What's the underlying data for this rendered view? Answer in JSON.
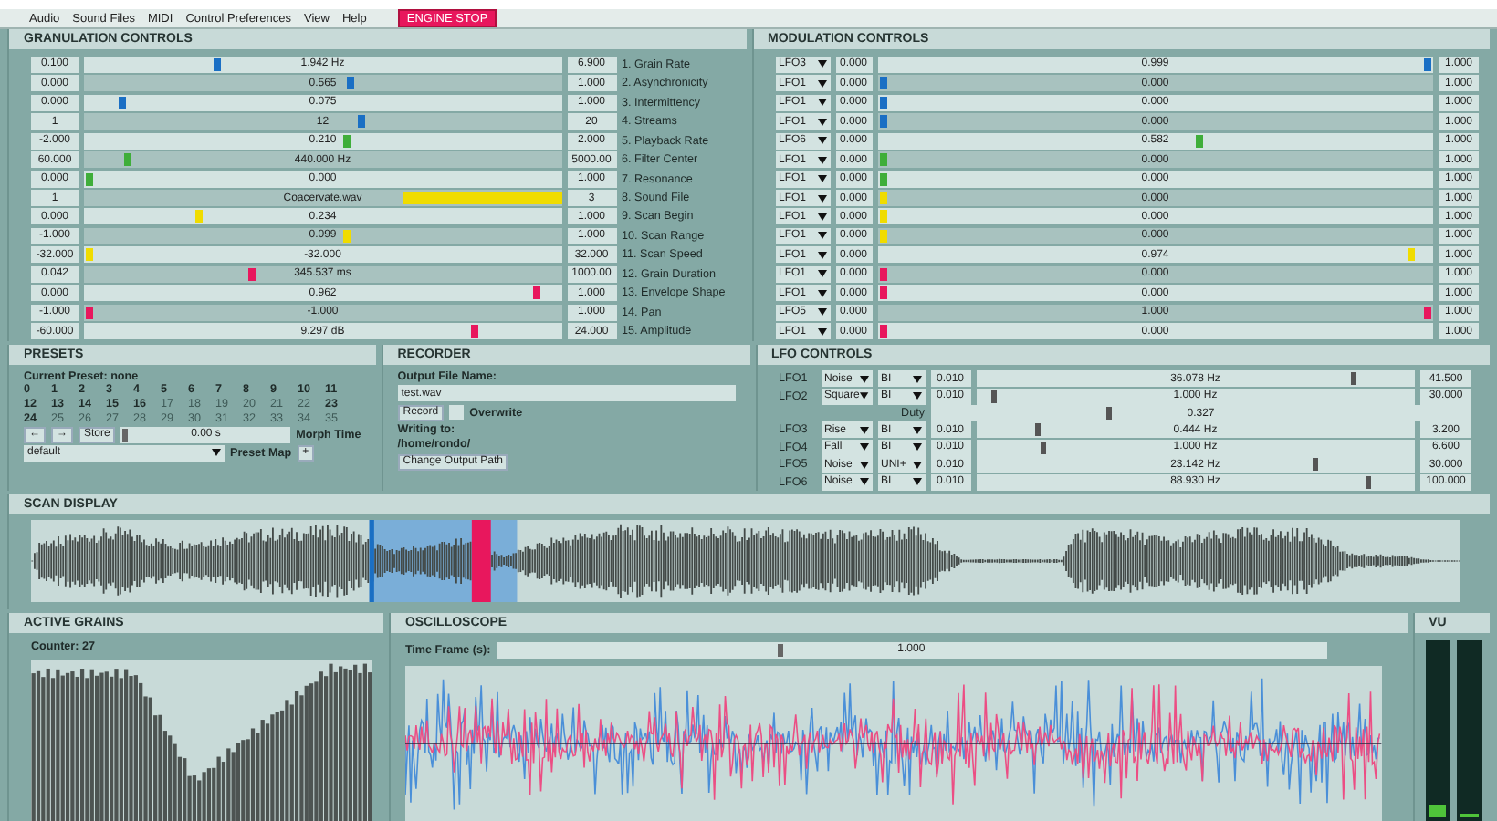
{
  "menu": {
    "items": [
      "Audio",
      "Sound Files",
      "MIDI",
      "Control Preferences",
      "View",
      "Help"
    ],
    "engine_button": "ENGINE STOP"
  },
  "granulation": {
    "title": "GRANULATION CONTROLS",
    "rows": [
      {
        "min": "0.100",
        "value": "1.942 Hz",
        "level": 0.28,
        "max": "6.900",
        "label": "1. Grain Rate",
        "color": "#1a6fc4",
        "kind": "slider"
      },
      {
        "min": "0.000",
        "value": "0.565",
        "level": 0.56,
        "max": "1.000",
        "label": "2. Asynchronicity",
        "color": "#1a6fc4",
        "kind": "slider"
      },
      {
        "min": "0.000",
        "value": "0.075",
        "level": 0.08,
        "max": "1.000",
        "label": "3. Intermittency",
        "color": "#1a6fc4",
        "kind": "slider"
      },
      {
        "min": "1",
        "value": "12",
        "level": 0.58,
        "max": "20",
        "label": "4. Streams",
        "color": "#1a6fc4",
        "kind": "slider"
      },
      {
        "min": "-2.000",
        "value": "0.210",
        "level": 0.55,
        "max": "2.000",
        "label": "5. Playback Rate",
        "color": "#3fae3a",
        "kind": "slider"
      },
      {
        "min": "60.000",
        "value": "440.000 Hz",
        "level": 0.09,
        "max": "5000.00",
        "label": "6. Filter Center",
        "color": "#3fae3a",
        "kind": "slider"
      },
      {
        "min": "0.000",
        "value": "0.000",
        "level": 0.01,
        "max": "1.000",
        "label": "7. Resonance",
        "color": "#3fae3a",
        "kind": "slider"
      },
      {
        "min": "1",
        "value": "Coacervate.wav",
        "max": "3",
        "label": "8. Sound File",
        "color": "#f0dc00",
        "kind": "file"
      },
      {
        "min": "0.000",
        "value": "0.234",
        "level": 0.24,
        "max": "1.000",
        "label": "9. Scan Begin",
        "color": "#f0dc00",
        "kind": "slider"
      },
      {
        "min": "-1.000",
        "value": "0.099",
        "level": 0.55,
        "max": "1.000",
        "label": "10. Scan Range",
        "color": "#f0dc00",
        "kind": "slider"
      },
      {
        "min": "-32.000",
        "value": "-32.000",
        "level": 0.01,
        "max": "32.000",
        "label": "11. Scan Speed",
        "color": "#f0dc00",
        "kind": "slider"
      },
      {
        "min": "0.042",
        "value": "345.537 ms",
        "level": 0.35,
        "max": "1000.00",
        "label": "12. Grain Duration",
        "color": "#e8175d",
        "kind": "slider"
      },
      {
        "min": "0.000",
        "value": "0.962",
        "level": 0.95,
        "max": "1.000",
        "label": "13. Envelope Shape",
        "color": "#e8175d",
        "kind": "slider"
      },
      {
        "min": "-1.000",
        "value": "-1.000",
        "level": 0.01,
        "max": "1.000",
        "label": "14. Pan",
        "color": "#e8175d",
        "kind": "slider"
      },
      {
        "min": "-60.000",
        "value": "9.297 dB",
        "level": 0.82,
        "max": "24.000",
        "label": "15. Amplitude",
        "color": "#e8175d",
        "kind": "slider"
      }
    ]
  },
  "modulation": {
    "title": "MODULATION CONTROLS",
    "rows": [
      {
        "source": "LFO3",
        "min": "0.000",
        "value": "0.999",
        "level": 0.99,
        "max": "1.000",
        "color": "#1a6fc4"
      },
      {
        "source": "LFO1",
        "min": "0.000",
        "value": "0.000",
        "level": 0.01,
        "max": "1.000",
        "color": "#1a6fc4"
      },
      {
        "source": "LFO1",
        "min": "0.000",
        "value": "0.000",
        "level": 0.01,
        "max": "1.000",
        "color": "#1a6fc4"
      },
      {
        "source": "LFO1",
        "min": "0.000",
        "value": "0.000",
        "level": 0.01,
        "max": "1.000",
        "color": "#1a6fc4"
      },
      {
        "source": "LFO6",
        "min": "0.000",
        "value": "0.582",
        "level": 0.58,
        "max": "1.000",
        "color": "#3fae3a"
      },
      {
        "source": "LFO1",
        "min": "0.000",
        "value": "0.000",
        "level": 0.01,
        "max": "1.000",
        "color": "#3fae3a"
      },
      {
        "source": "LFO1",
        "min": "0.000",
        "value": "0.000",
        "level": 0.01,
        "max": "1.000",
        "color": "#3fae3a"
      },
      {
        "source": "LFO1",
        "min": "0.000",
        "value": "0.000",
        "level": 0.01,
        "max": "1.000",
        "color": "#f0dc00"
      },
      {
        "source": "LFO1",
        "min": "0.000",
        "value": "0.000",
        "level": 0.01,
        "max": "1.000",
        "color": "#f0dc00"
      },
      {
        "source": "LFO1",
        "min": "0.000",
        "value": "0.000",
        "level": 0.01,
        "max": "1.000",
        "color": "#f0dc00"
      },
      {
        "source": "LFO1",
        "min": "0.000",
        "value": "0.974",
        "level": 0.96,
        "max": "1.000",
        "color": "#f0dc00"
      },
      {
        "source": "LFO1",
        "min": "0.000",
        "value": "0.000",
        "level": 0.01,
        "max": "1.000",
        "color": "#e8175d"
      },
      {
        "source": "LFO1",
        "min": "0.000",
        "value": "0.000",
        "level": 0.01,
        "max": "1.000",
        "color": "#e8175d"
      },
      {
        "source": "LFO5",
        "min": "0.000",
        "value": "1.000",
        "level": 0.99,
        "max": "1.000",
        "color": "#e8175d"
      },
      {
        "source": "LFO1",
        "min": "0.000",
        "value": "0.000",
        "level": 0.01,
        "max": "1.000",
        "color": "#e8175d"
      }
    ]
  },
  "presets": {
    "title": "PRESETS",
    "current": "Current Preset: none",
    "slots": [
      {
        "label": "0",
        "stored": true
      },
      {
        "label": "1",
        "stored": true
      },
      {
        "label": "2",
        "stored": true
      },
      {
        "label": "3",
        "stored": true
      },
      {
        "label": "4",
        "stored": true
      },
      {
        "label": "5",
        "stored": true
      },
      {
        "label": "6",
        "stored": true
      },
      {
        "label": "7",
        "stored": true
      },
      {
        "label": "8",
        "stored": true
      },
      {
        "label": "9",
        "stored": true
      },
      {
        "label": "10",
        "stored": true
      },
      {
        "label": "11",
        "stored": true
      },
      {
        "label": "12",
        "stored": true
      },
      {
        "label": "13",
        "stored": true
      },
      {
        "label": "14",
        "stored": true
      },
      {
        "label": "15",
        "stored": true
      },
      {
        "label": "16",
        "stored": true
      },
      {
        "label": "17",
        "stored": false
      },
      {
        "label": "18",
        "stored": false
      },
      {
        "label": "19",
        "stored": false
      },
      {
        "label": "20",
        "stored": false
      },
      {
        "label": "21",
        "stored": false
      },
      {
        "label": "22",
        "stored": false
      },
      {
        "label": "23",
        "stored": true
      },
      {
        "label": "24",
        "stored": true
      },
      {
        "label": "25",
        "stored": false
      },
      {
        "label": "26",
        "stored": false
      },
      {
        "label": "27",
        "stored": false
      },
      {
        "label": "28",
        "stored": false
      },
      {
        "label": "29",
        "stored": false
      },
      {
        "label": "30",
        "stored": false
      },
      {
        "label": "31",
        "stored": false
      },
      {
        "label": "32",
        "stored": false
      },
      {
        "label": "33",
        "stored": false
      },
      {
        "label": "34",
        "stored": false
      },
      {
        "label": "35",
        "stored": false
      }
    ],
    "prev": "←",
    "next": "→",
    "store": "Store",
    "morph": {
      "value": "0.00 s",
      "level": 0.01,
      "label": "Morph Time"
    },
    "map": {
      "value": "default",
      "label": "Preset Map",
      "add": "+"
    }
  },
  "recorder": {
    "title": "RECORDER",
    "file_label": "Output File Name:",
    "file_value": "test.wav",
    "record": "Record",
    "overwrite": {
      "label": "Overwrite",
      "checked": false
    },
    "writing_label": "Writing to:",
    "path": "/home/rondo/",
    "change_path": "Change Output Path"
  },
  "lfo": {
    "title": "LFO CONTROLS",
    "rows": [
      {
        "kind": "lfo",
        "name": "LFO1",
        "shape": "Noise",
        "polarity": "BI",
        "min": "0.010",
        "value": "36.078 Hz",
        "level": 0.86,
        "max": "41.500"
      },
      {
        "kind": "lfo",
        "name": "LFO2",
        "shape": "Square",
        "polarity": "BI",
        "min": "0.010",
        "value": "1.000 Hz",
        "level": 0.04,
        "max": "30.000"
      },
      {
        "kind": "duty",
        "name": "Duty",
        "value": "0.327",
        "level": 0.33
      },
      {
        "kind": "lfo",
        "name": "LFO3",
        "shape": "Rise",
        "polarity": "BI",
        "min": "0.010",
        "value": "0.444 Hz",
        "level": 0.14,
        "max": "3.200"
      },
      {
        "kind": "lfo",
        "name": "LFO4",
        "shape": "Fall",
        "polarity": "BI",
        "min": "0.010",
        "value": "1.000 Hz",
        "level": 0.15,
        "max": "6.600"
      },
      {
        "kind": "lfo",
        "name": "LFO5",
        "shape": "Noise",
        "polarity": "UNI+",
        "min": "0.010",
        "value": "23.142 Hz",
        "level": 0.77,
        "max": "30.000"
      },
      {
        "kind": "lfo",
        "name": "LFO6",
        "shape": "Noise",
        "polarity": "BI",
        "min": "0.010",
        "value": "88.930 Hz",
        "level": 0.89,
        "max": "100.000"
      }
    ]
  },
  "scan": {
    "title": "SCAN DISPLAY"
  },
  "grains": {
    "title": "ACTIVE GRAINS",
    "counter": "Counter: 27"
  },
  "oscilloscope": {
    "title": "OSCILLOSCOPE",
    "time_label": "Time Frame (s):",
    "time_value": "1.000",
    "level": 0.34
  },
  "vu": {
    "title": "VU",
    "meters": [
      {
        "level": 0.07
      },
      {
        "level": 0.02
      }
    ]
  }
}
